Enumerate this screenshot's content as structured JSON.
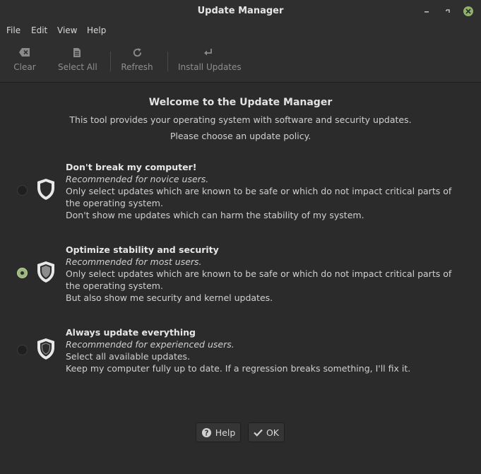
{
  "window": {
    "title": "Update Manager"
  },
  "menu": [
    "File",
    "Edit",
    "View",
    "Help"
  ],
  "toolbar": {
    "clear_label": "Clear",
    "select_all_label": "Select All",
    "refresh_label": "Refresh",
    "install_label": "Install Updates"
  },
  "welcome": {
    "heading": "Welcome to the Update Manager",
    "line1": "This tool provides your operating system with software and security updates.",
    "line2": "Please choose an update policy."
  },
  "options": [
    {
      "title": "Don't break my computer!",
      "recommendation": "Recommended for novice users.",
      "desc1": "Only select updates which are known to be safe or which do not impact critical parts of the operating system.",
      "desc2": "Don't show me updates which can harm the stability of my system.",
      "selected": false,
      "icon": "shield-outline-icon"
    },
    {
      "title": "Optimize stability and security",
      "recommendation": "Recommended for most users.",
      "desc1": "Only select updates which are known to be safe or which do not impact critical parts of the operating system.",
      "desc2": "But also show me security and kernel updates.",
      "selected": true,
      "icon": "shield-half-icon"
    },
    {
      "title": "Always update everything",
      "recommendation": "Recommended for experienced users.",
      "desc1": "Select all available updates.",
      "desc2": "Keep my computer fully up to date. If a regression breaks something, I'll fix it.",
      "selected": false,
      "icon": "shield-empty-icon"
    }
  ],
  "buttons": {
    "help_label": "Help",
    "ok_label": "OK"
  },
  "colors": {
    "accent": "#9ab87c",
    "close_button": "#8fb26b",
    "background": "#2b2b2b"
  }
}
